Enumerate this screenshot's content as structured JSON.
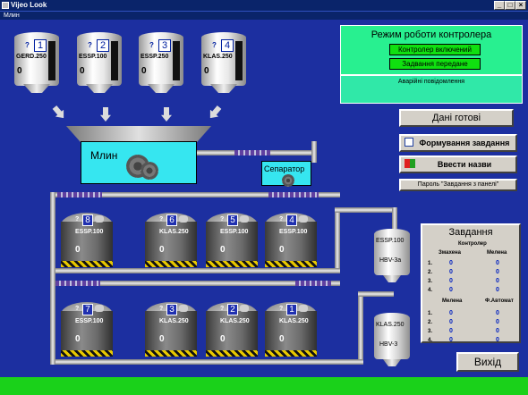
{
  "window": {
    "title": "Vijeo Look",
    "subtitle": "Млин",
    "min": "_",
    "max": "□",
    "close": "×"
  },
  "silos": [
    {
      "num": "1",
      "q": "?",
      "name": "GERD.250",
      "value": "0"
    },
    {
      "num": "2",
      "q": "?",
      "name": "ESSP.100",
      "value": "0"
    },
    {
      "num": "3",
      "q": "?",
      "name": "ESSP.250",
      "value": "0"
    },
    {
      "num": "4",
      "q": "?",
      "name": "KLAS.250",
      "value": "0"
    }
  ],
  "mill": {
    "label": "Млин"
  },
  "separator": {
    "label": "Сепаратор"
  },
  "tanks_row1": [
    {
      "num": "8",
      "q": "?",
      "name": "ESSP.100",
      "value": "0"
    },
    {
      "num": "6",
      "q": "?",
      "name": "KLAS.250",
      "value": "0"
    },
    {
      "num": "5",
      "q": "?",
      "name": "ESSP.100",
      "value": "0"
    },
    {
      "num": "4",
      "q": "?",
      "name": "ESSP.100",
      "value": "0"
    }
  ],
  "tanks_row2": [
    {
      "num": "7",
      "q": "?",
      "name": "ESSP.100",
      "value": "0"
    },
    {
      "num": "3",
      "q": "?",
      "name": "KLAS.250",
      "value": "0"
    },
    {
      "num": "2",
      "q": "?",
      "name": "KLAS.250",
      "value": "0"
    },
    {
      "num": "1",
      "q": "?",
      "name": "KLAS.250",
      "value": "0"
    }
  ],
  "hbv": [
    {
      "name": "ESSP.100",
      "sub": "HBV-3a"
    },
    {
      "name": "KLAS.250",
      "sub": "HBV-3"
    }
  ],
  "mode_panel": {
    "title": "Режим роботи контролера",
    "state1": "Контролер включений",
    "state2": "Задвання передане"
  },
  "alarm_panel": {
    "title": "Аварійні повідомлення"
  },
  "buttons": {
    "data_ready": "Дані готові",
    "form_task": "Формування завдання",
    "enter_names": "Ввести назви",
    "panel_password": "Пароль \"Завдання з панелі\"",
    "exit": "Вихід"
  },
  "tasks": {
    "title": "Завдання",
    "controller": "Контролер",
    "col1a": "Змахена",
    "col1b": "Мелена",
    "col2a": "Мелена",
    "col2b": "Ф.Автомат",
    "rows": [
      "1.",
      "2.",
      "3.",
      "4."
    ],
    "rows2": [
      "1.",
      "2.",
      "3.",
      "4."
    ],
    "zero": "0"
  }
}
